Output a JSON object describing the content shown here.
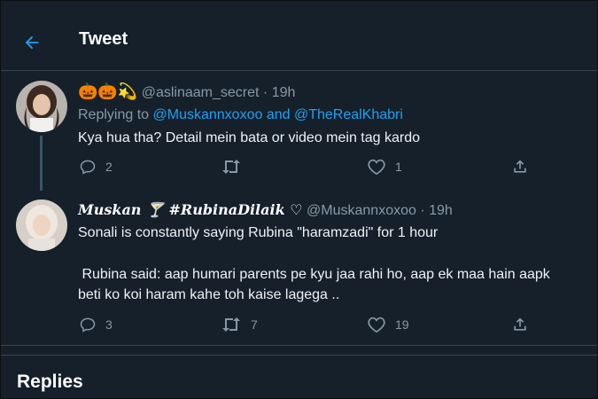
{
  "header": {
    "title": "Tweet"
  },
  "tweet1": {
    "emojis": "🎃🎃💫",
    "handle": "@aslinaam_secret",
    "separator": "·",
    "time": "19h",
    "replying_prefix": "Replying to",
    "replying_user1": "@Muskannxoxoo",
    "replying_and": "and",
    "replying_user2": "@TheRealKhabri",
    "text": "Kya hua tha? Detail mein bata or video mein tag kardo",
    "replies": "2",
    "retweets": "",
    "likes": "1"
  },
  "tweet2": {
    "display_name": "𝑴𝒖𝒔𝒌𝒂𝒏 🍸 #𝑹𝒖𝒃𝒊𝒏𝒂𝑫𝒊𝒍𝒂𝒊𝒌 ♡",
    "handle": "@Muskannxoxoo",
    "separator": "·",
    "time": "19h",
    "line1": "Sonali is constantly saying Rubina \"haramzadi\" for 1 hour",
    "line2": " Rubina said: aap humari parents pe kyu jaa rahi ho, aap ek maa hain aapk",
    "line3": "beti ko koi haram kahe toh kaise lagega ..",
    "replies": "3",
    "retweets": "7",
    "likes": "19"
  },
  "replies_section": {
    "title": "Replies"
  },
  "colors": {
    "background": "#15202b",
    "accent": "#1da1f2",
    "muted": "#8899a6",
    "divider": "#38444d"
  }
}
